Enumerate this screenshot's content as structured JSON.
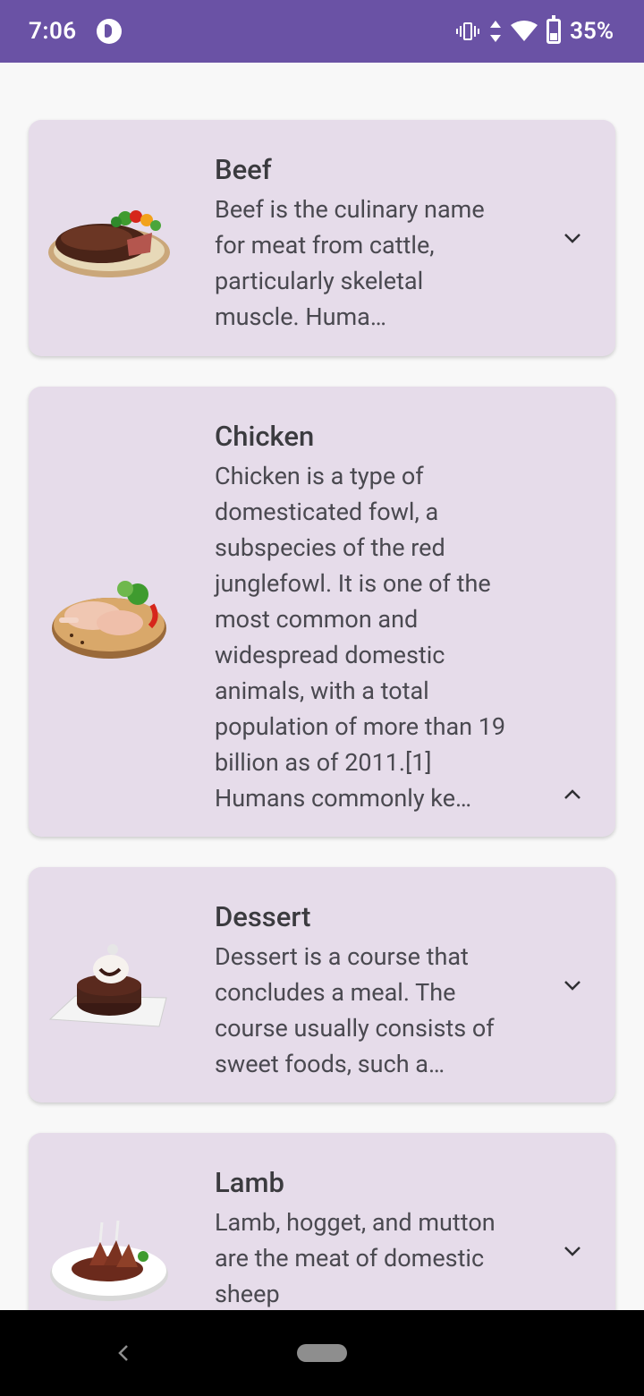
{
  "status_bar": {
    "time": "7:06",
    "battery": "35%",
    "icons": [
      "app-indicator-icon",
      "vibrate-icon",
      "data-arrows-icon",
      "wifi-icon",
      "battery-icon"
    ]
  },
  "cards": [
    {
      "title": "Beef",
      "description": "Beef is the culinary name for meat from cattle, particularly skeletal muscle. Huma…",
      "image": "steak-plate-image",
      "chevron": "chevron-down-icon"
    },
    {
      "title": "Chicken",
      "description": "Chicken is a type of domesticated fowl, a subspecies of the red junglefowl. It is one of the most common and widespread domestic animals, with a total population of more than 19 billion as of 2011.[1] Humans commonly ke…",
      "image": "chicken-legs-plate-image",
      "chevron": "chevron-up-icon"
    },
    {
      "title": "Dessert",
      "description": "Dessert is a course that concludes a meal. The course usually consists of sweet foods, such a…",
      "image": "chocolate-cake-image",
      "chevron": "chevron-down-icon"
    },
    {
      "title": "Lamb",
      "description": "Lamb, hogget, and mutton are the meat of domestic sheep",
      "image": "lamb-chops-plate-image",
      "chevron": "chevron-down-icon"
    }
  ],
  "nav_bar": {
    "icons": [
      "back-icon",
      "home-pill"
    ]
  },
  "colors": {
    "status_bar": "#6a52a5",
    "card_background": "#e6dcea",
    "page_background": "#f8f8f8",
    "nav_bar": "#000000"
  }
}
